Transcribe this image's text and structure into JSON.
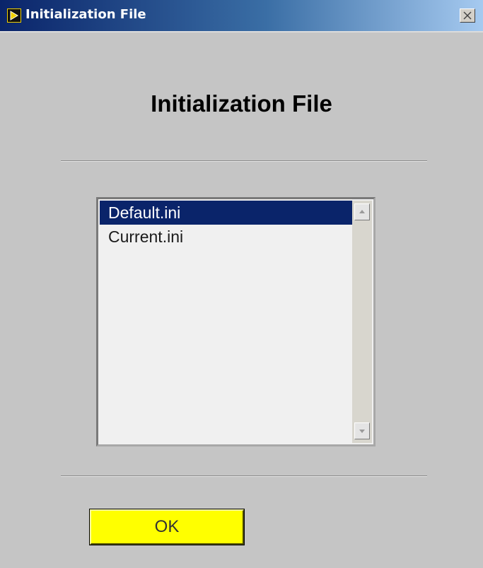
{
  "window": {
    "title": "Initialization File",
    "icon": "labview-run-arrow-icon",
    "close_icon": "close-x-icon"
  },
  "heading": "Initialization File",
  "file_list": {
    "items": [
      {
        "label": "Default.ini",
        "selected": true
      },
      {
        "label": "Current.ini",
        "selected": false
      }
    ],
    "scroll_up_icon": "scroll-up-arrow-icon",
    "scroll_down_icon": "scroll-down-arrow-icon"
  },
  "ok_button": {
    "label": "OK"
  },
  "colors": {
    "title_gradient_start": "#0a246a",
    "title_gradient_end": "#a6caf0",
    "panel_background": "#c5c5c5",
    "selection": "#0a246a",
    "ok_button": "#ffff00"
  }
}
